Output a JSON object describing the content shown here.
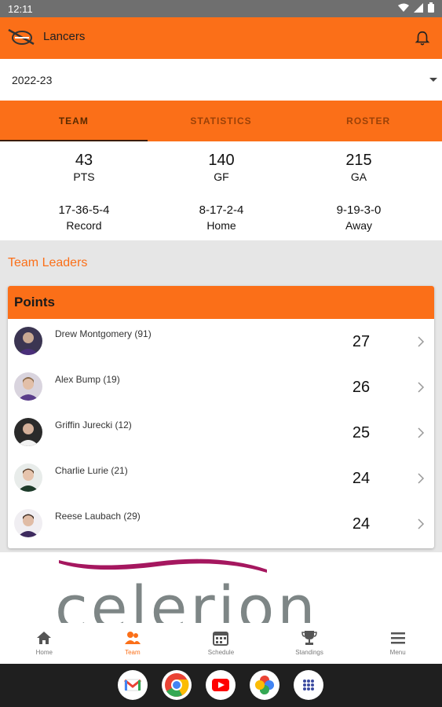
{
  "status": {
    "time": "12:11"
  },
  "app": {
    "title": "Lancers"
  },
  "season": {
    "value": "2022-23"
  },
  "tabs": [
    {
      "label": "TEAM"
    },
    {
      "label": "STATISTICS"
    },
    {
      "label": "ROSTER"
    }
  ],
  "stats": {
    "pts": {
      "value": "43",
      "label": "PTS"
    },
    "gf": {
      "value": "140",
      "label": "GF"
    },
    "ga": {
      "value": "215",
      "label": "GA"
    },
    "record": {
      "value": "17-36-5-4",
      "label": "Record"
    },
    "home": {
      "value": "8-17-2-4",
      "label": "Home"
    },
    "away": {
      "value": "9-19-3-0",
      "label": "Away"
    }
  },
  "leaders": {
    "title": "Team Leaders",
    "card_title": "Points",
    "players": [
      {
        "name": "Drew Montgomery (91)",
        "value": "27"
      },
      {
        "name": "Alex Bump (19)",
        "value": "26"
      },
      {
        "name": "Griffin Jurecki (12)",
        "value": "25"
      },
      {
        "name": "Charlie Lurie (21)",
        "value": "24"
      },
      {
        "name": "Reese Laubach (29)",
        "value": "24"
      }
    ]
  },
  "ad": {
    "text": "celerion"
  },
  "nav": [
    {
      "label": "Home",
      "icon": "home-icon"
    },
    {
      "label": "Team",
      "icon": "team-icon"
    },
    {
      "label": "Schedule",
      "icon": "calendar-icon"
    },
    {
      "label": "Standings",
      "icon": "trophy-icon"
    },
    {
      "label": "Menu",
      "icon": "menu-icon"
    }
  ],
  "dock": [
    "gmail-icon",
    "chrome-icon",
    "youtube-icon",
    "photos-icon",
    "apps-icon"
  ],
  "colors": {
    "accent": "#fb6f18",
    "status_bar": "#6f6f6f",
    "dock": "#1f1f1f"
  }
}
